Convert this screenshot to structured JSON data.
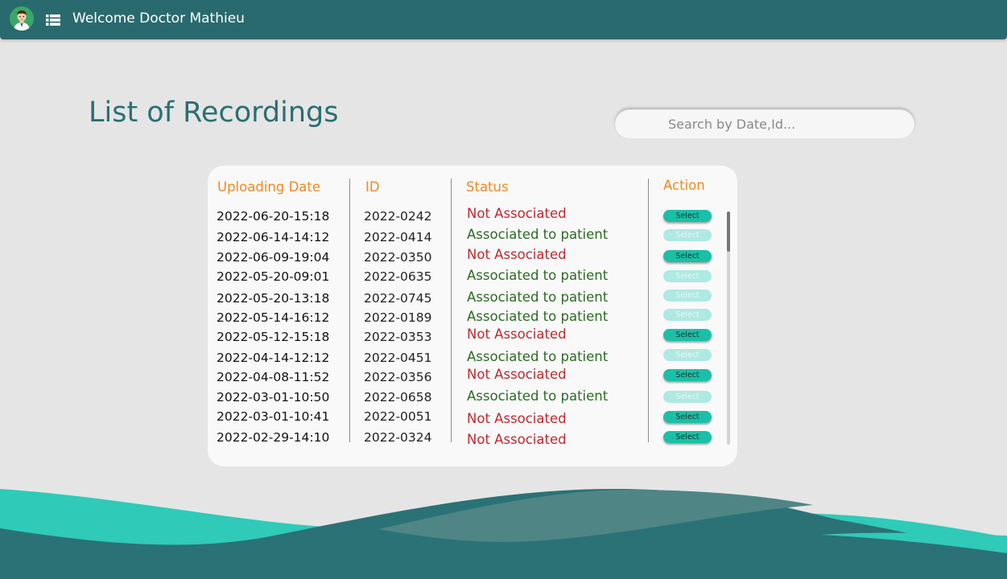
{
  "header": {
    "welcome": "Welcome Doctor Mathieu",
    "avatar_icon": "doctor-avatar-icon",
    "menu_icon": "list-menu-icon"
  },
  "page": {
    "title": "List of Recordings"
  },
  "search": {
    "placeholder": "Search by Date,Id..."
  },
  "table": {
    "columns": {
      "date": "Uploading Date",
      "id": "ID",
      "status": "Status",
      "action": "Action"
    },
    "rows": [
      {
        "date": "2022-06-20-15:18",
        "id": "2022-0242",
        "status": "Not Associated",
        "associated": false,
        "action": "Select"
      },
      {
        "date": "2022-06-14-14:12",
        "id": "2022-0414",
        "status": "Associated to patient",
        "associated": true,
        "action": "Select"
      },
      {
        "date": "2022-06-09-19:04",
        "id": "2022-0350",
        "status": "Not Associated",
        "associated": false,
        "action": "Select"
      },
      {
        "date": "2022-05-20-09:01",
        "id": "2022-0635",
        "status": "Associated to patient",
        "associated": true,
        "action": "Select"
      },
      {
        "date": "2022-05-20-13:18",
        "id": "2022-0745",
        "status": "Associated to patient",
        "associated": true,
        "action": "Select"
      },
      {
        "date": "2022-05-14-16:12",
        "id": "2022-0189",
        "status": "Associated to patient",
        "associated": true,
        "action": "Select"
      },
      {
        "date": "2022-05-12-15:18",
        "id": "2022-0353",
        "status": "Not Associated",
        "associated": false,
        "action": "Select"
      },
      {
        "date": "2022-04-14-12:12",
        "id": "2022-0451",
        "status": "Associated to patient",
        "associated": true,
        "action": "Select"
      },
      {
        "date": "2022-04-08-11:52",
        "id": "2022-0356",
        "status": "Not Associated",
        "associated": false,
        "action": "Select"
      },
      {
        "date": "2022-03-01-10:50",
        "id": "2022-0658",
        "status": "Associated to patient",
        "associated": true,
        "action": "Select"
      },
      {
        "date": "2022-03-01-10:41",
        "id": "2022-0051",
        "status": "Not Associated",
        "associated": false,
        "action": "Select"
      },
      {
        "date": "2022-02-29-14:10",
        "id": "2022-0324",
        "status": "Not Associated",
        "associated": false,
        "action": "Select"
      }
    ]
  },
  "colors": {
    "topbar": "#296a6f",
    "title": "#2b6e72",
    "header_text": "#f0891e",
    "not_associated": "#c0282d",
    "associated": "#2c6a23",
    "select_enabled": "#19c0a7",
    "select_disabled": "#aee9e2",
    "wave_light": "#2fcab8",
    "wave_dark": "#2a7275"
  }
}
